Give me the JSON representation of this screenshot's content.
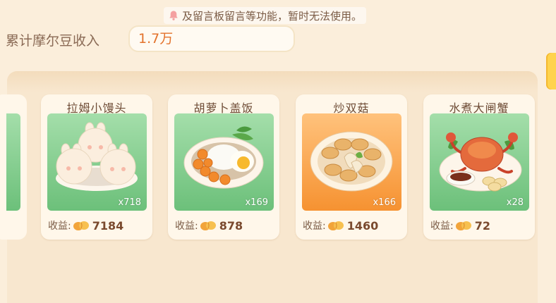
{
  "notice": {
    "text": "及留言板留言等功能，暂时无法使用。",
    "icon": "bell-icon"
  },
  "income": {
    "label": "累计摩尔豆收入",
    "value": "1.7万"
  },
  "earnings_label": "收益:",
  "dishes": [
    {
      "name": "拉姆小馒头",
      "qty": "x718",
      "earnings": "7184",
      "bg": "green"
    },
    {
      "name": "胡萝卜盖饭",
      "qty": "x169",
      "earnings": "878",
      "bg": "green"
    },
    {
      "name": "炒双菇",
      "qty": "x166",
      "earnings": "1460",
      "bg": "orange"
    },
    {
      "name": "水煮大闸蟹",
      "qty": "x28",
      "earnings": "72",
      "bg": "green"
    }
  ],
  "colors": {
    "accent": "#e3722c",
    "panel": "#f8e7cf",
    "card": "#fff7ea",
    "green_bg": "#8fd298",
    "orange_bg": "#f8a64a"
  }
}
